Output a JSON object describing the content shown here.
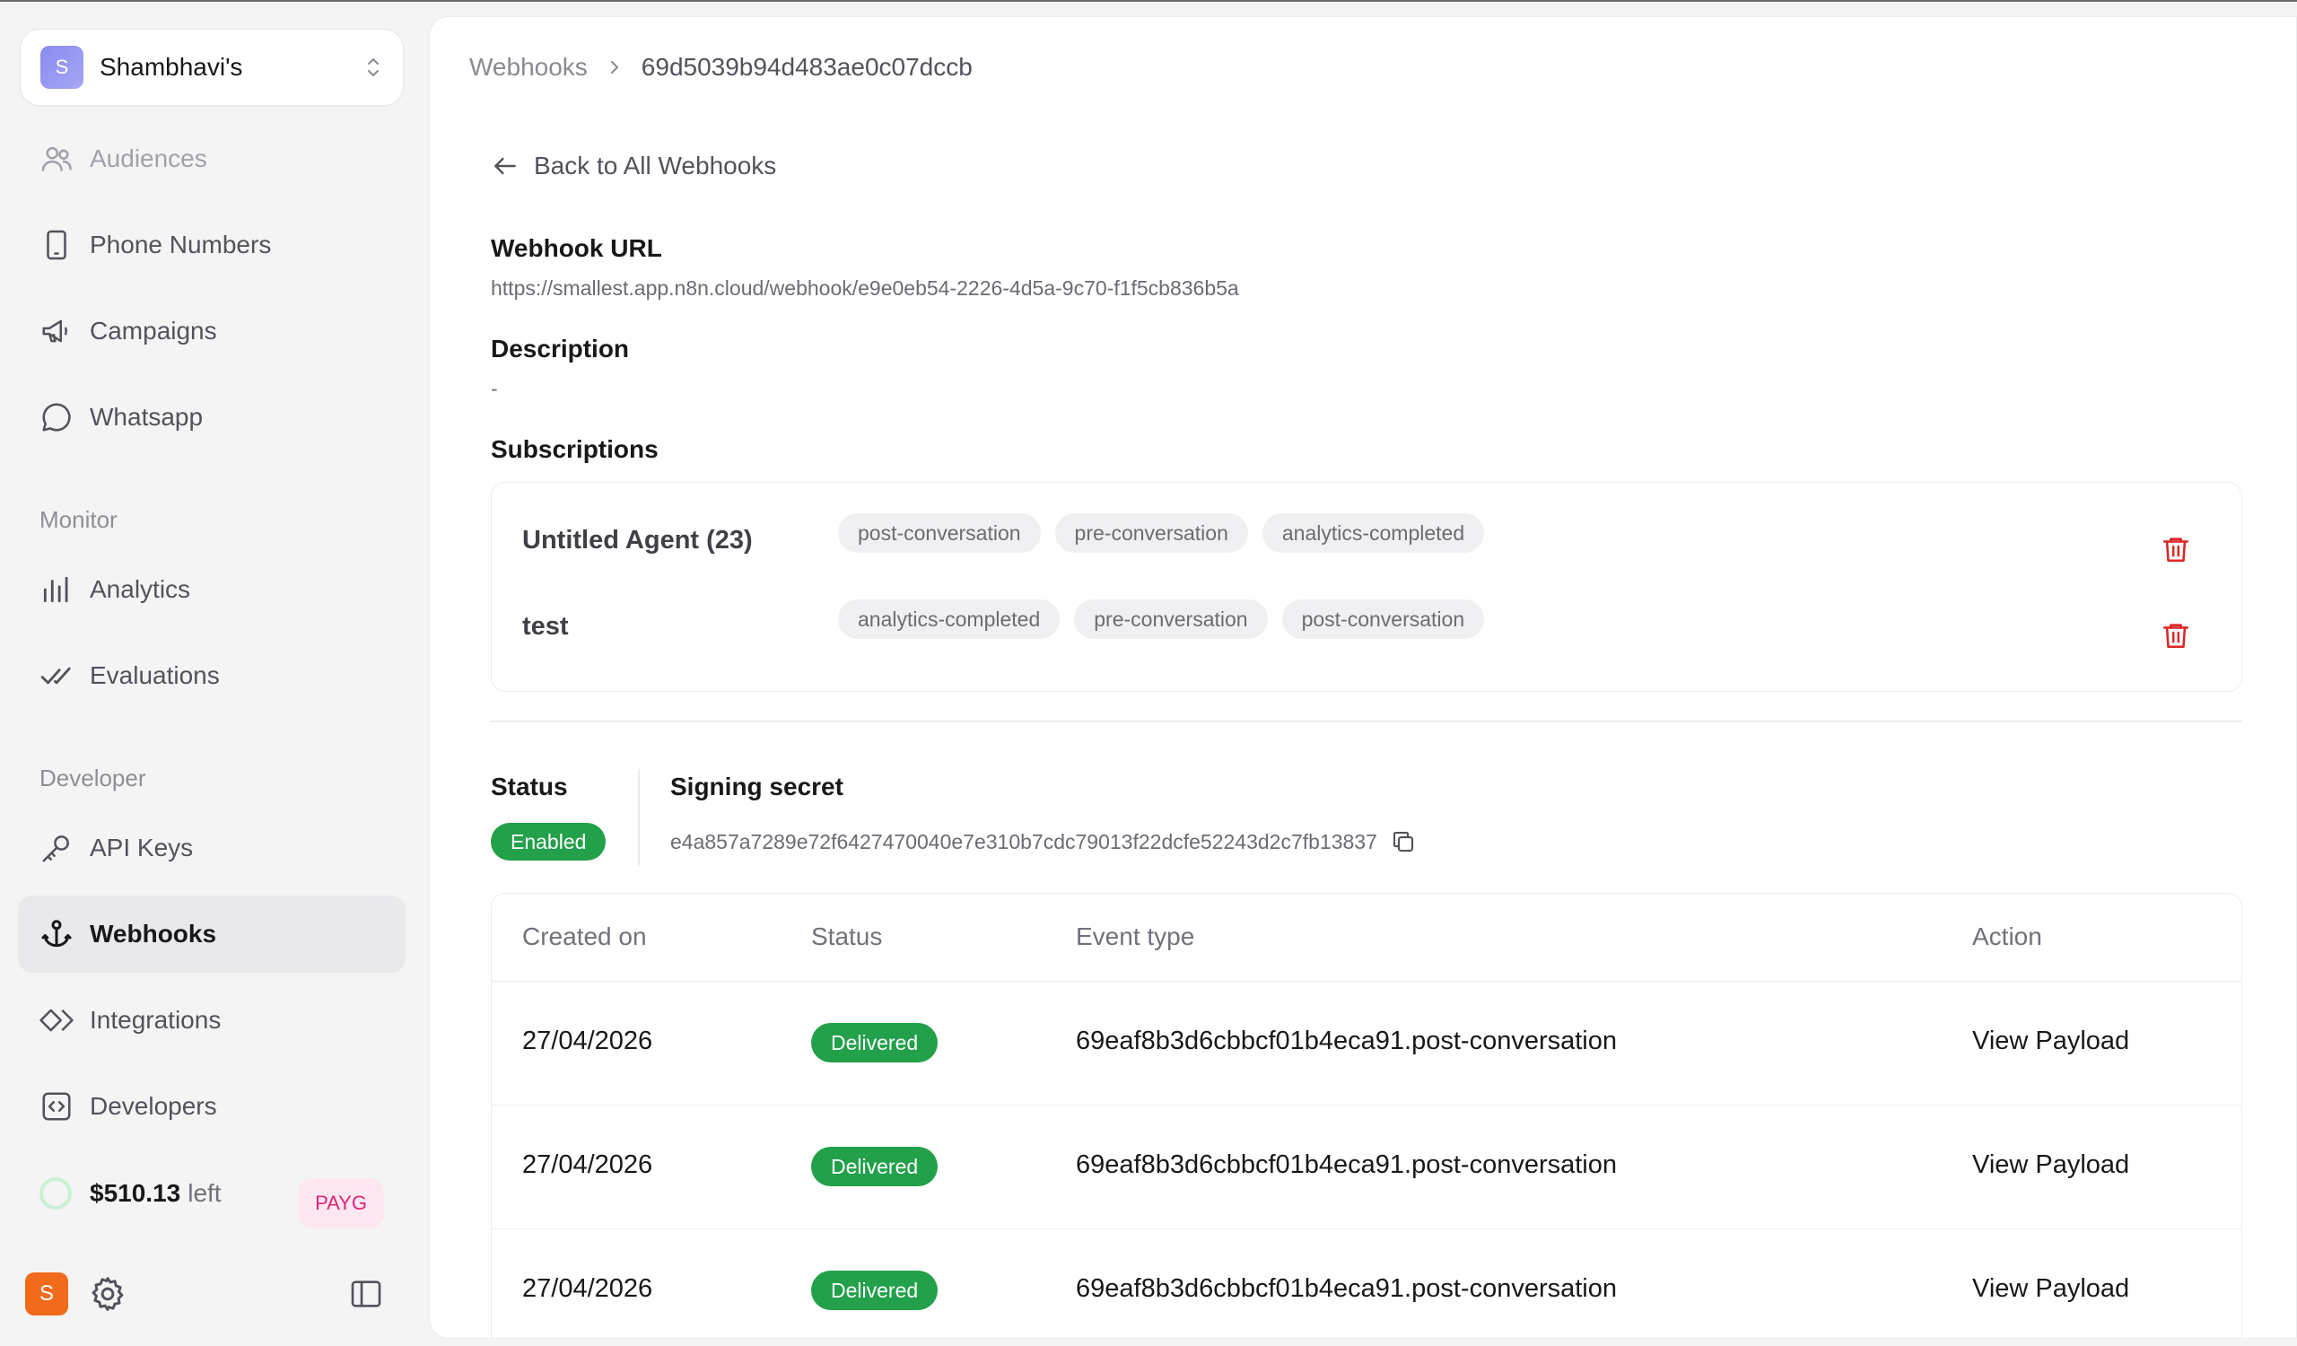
{
  "org": {
    "name": "Shambhavi's",
    "avatar_letter": "S"
  },
  "sidebar": {
    "items": [
      {
        "label": "Audiences",
        "icon": "users-icon"
      },
      {
        "label": "Phone Numbers",
        "icon": "phone-icon"
      },
      {
        "label": "Campaigns",
        "icon": "megaphone-icon"
      },
      {
        "label": "Whatsapp",
        "icon": "chat-bubble-icon"
      }
    ],
    "monitor_heading": "Monitor",
    "monitor_items": [
      {
        "label": "Analytics",
        "icon": "bar-chart-icon"
      },
      {
        "label": "Evaluations",
        "icon": "double-check-icon"
      }
    ],
    "developer_heading": "Developer",
    "developer_items": [
      {
        "label": "API Keys",
        "icon": "key-icon"
      },
      {
        "label": "Webhooks",
        "icon": "webhook-icon",
        "active": true
      },
      {
        "label": "Integrations",
        "icon": "integrations-icon"
      },
      {
        "label": "Developers",
        "icon": "code-icon"
      }
    ],
    "balance": {
      "amount": "$510.13",
      "suffix": "left",
      "plan": "PAYG"
    },
    "user_avatar_letter": "S"
  },
  "breadcrumb": {
    "root": "Webhooks",
    "current": "69d5039b94d483ae0c07dccb"
  },
  "back_label": "Back to All Webhooks",
  "webhook": {
    "url_label": "Webhook URL",
    "url": "https://smallest.app.n8n.cloud/webhook/e9e0eb54-2226-4d5a-9c70-f1f5cb836b5a",
    "description_label": "Description",
    "description": "-",
    "subscriptions_label": "Subscriptions",
    "subscriptions": [
      {
        "agent": "Untitled Agent (23)",
        "events": [
          "post-conversation",
          "pre-conversation",
          "analytics-completed"
        ]
      },
      {
        "agent": "test",
        "events": [
          "analytics-completed",
          "pre-conversation",
          "post-conversation"
        ]
      }
    ],
    "status_label": "Status",
    "status": "Enabled",
    "secret_label": "Signing secret",
    "secret": "e4a857a7289e72f6427470040e7e310b7cdc79013f22dcfe52243d2c7fb13837"
  },
  "table": {
    "headers": [
      "Created on",
      "Status",
      "Event type",
      "Action"
    ],
    "rows": [
      {
        "created": "27/04/2026",
        "status": "Delivered",
        "event": "69eaf8b3d6cbbcf01b4eca91.post-conversation",
        "action": "View Payload"
      },
      {
        "created": "27/04/2026",
        "status": "Delivered",
        "event": "69eaf8b3d6cbbcf01b4eca91.post-conversation",
        "action": "View Payload"
      },
      {
        "created": "27/04/2026",
        "status": "Delivered",
        "event": "69eaf8b3d6cbbcf01b4eca91.post-conversation",
        "action": "View Payload"
      }
    ]
  },
  "colors": {
    "success": "#22a04a",
    "danger": "#dc2626",
    "payg": "#db2777"
  }
}
